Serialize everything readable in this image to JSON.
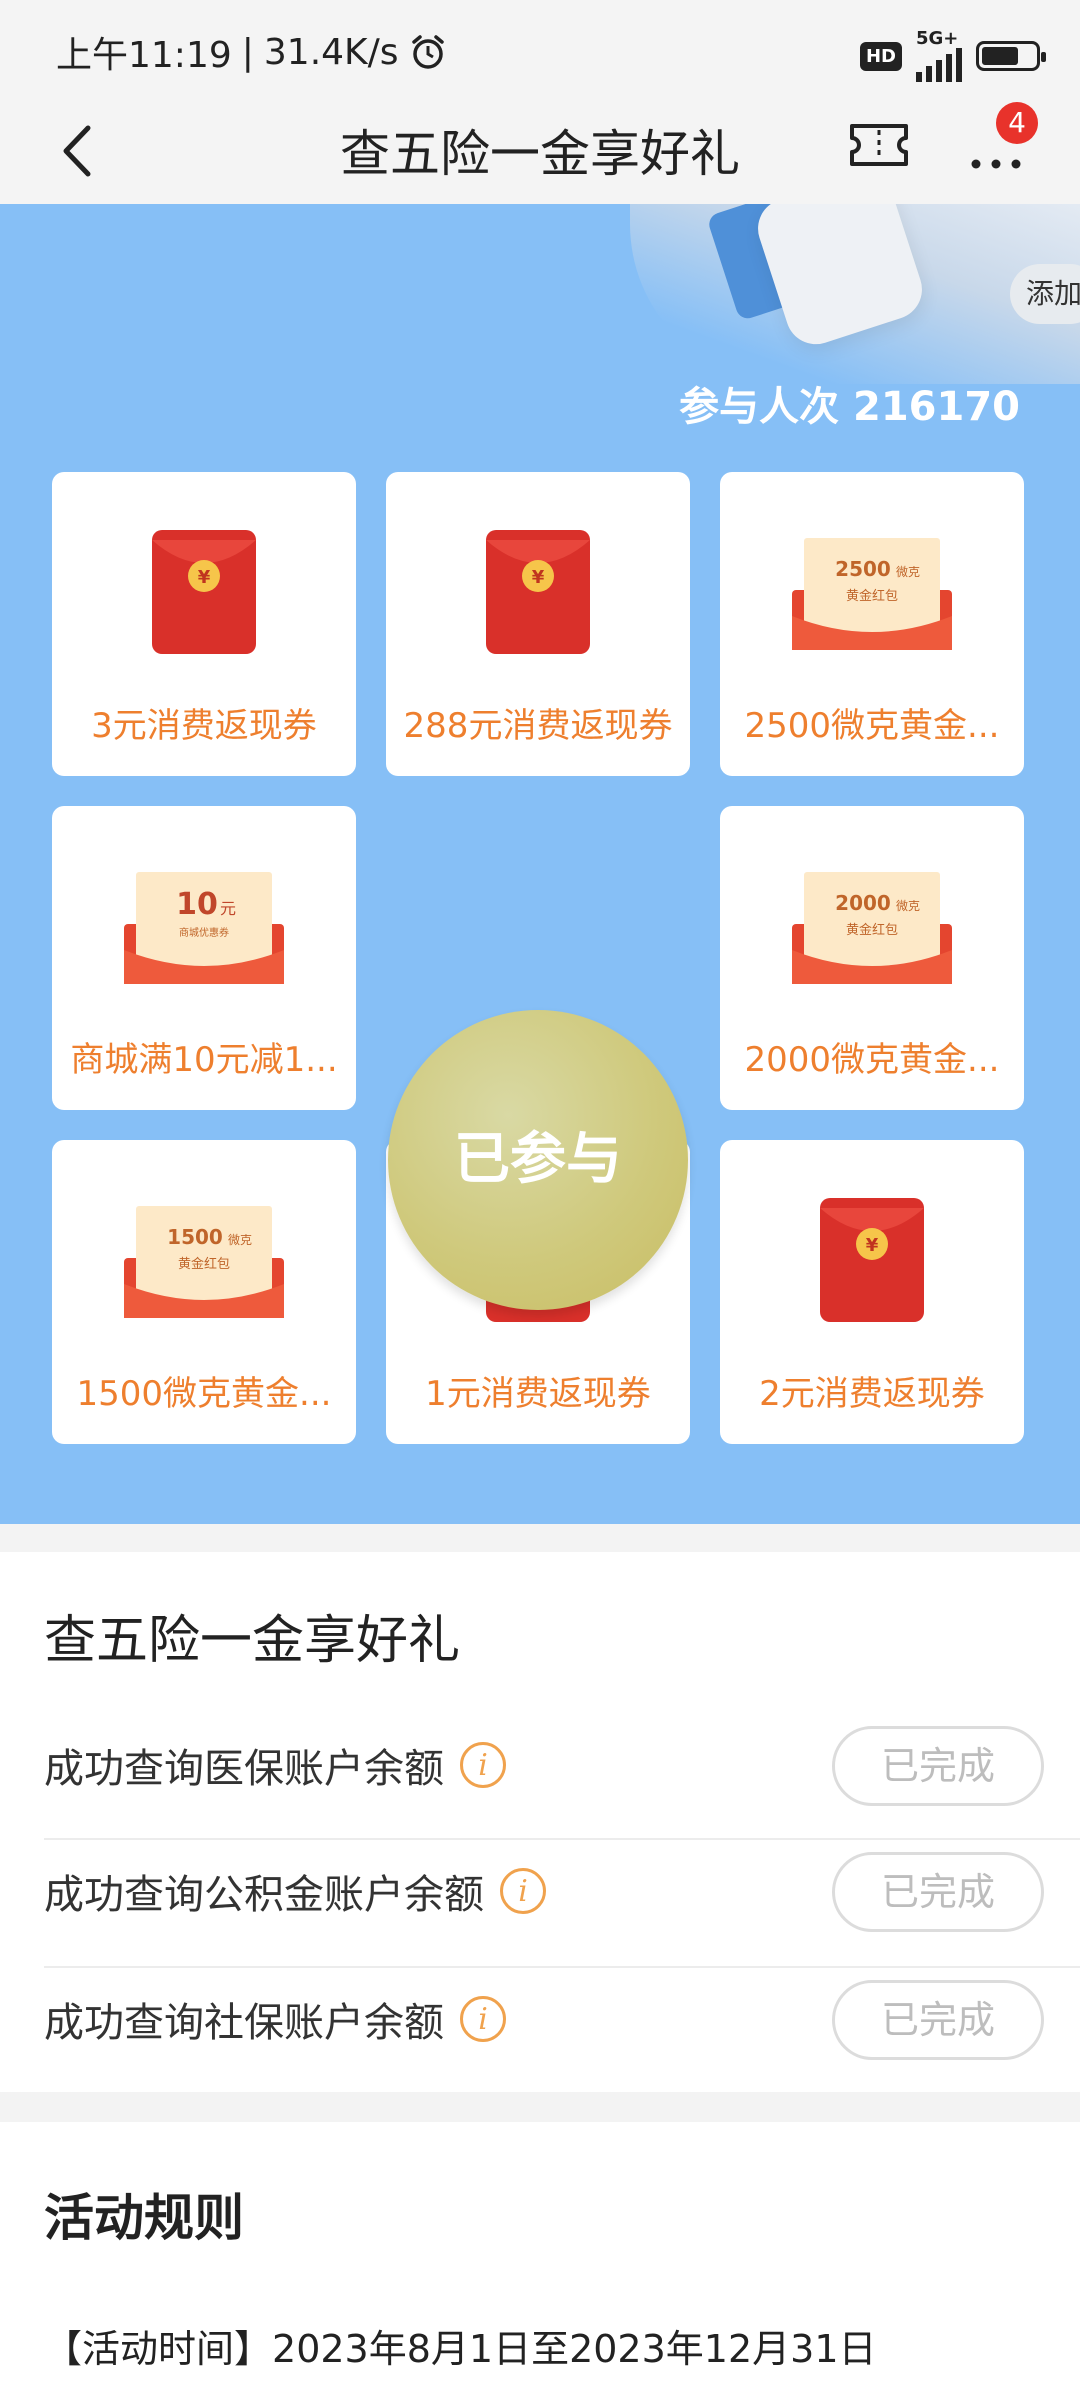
{
  "status_bar": {
    "time": "上午11:19",
    "speed": "31.4K/s",
    "hd": "HD",
    "network": "5G+"
  },
  "nav": {
    "title": "查五险一金享好礼",
    "badge_count": "4"
  },
  "banner": {
    "add_label": "添加",
    "participants_label": "参与人次",
    "participants_count": "216170",
    "center_button": "已参与",
    "prizes": [
      {
        "label": "3元消费返现券",
        "art": "red-envelope"
      },
      {
        "label": "288元消费返现券",
        "art": "red-envelope"
      },
      {
        "label": "2500微克黄金...",
        "art": "gold-envelope",
        "amount": "2500",
        "unit": "微克",
        "sub": "黄金红包"
      },
      {
        "label": "商城满10元减1...",
        "art": "coupon-envelope",
        "amount": "10",
        "unit": "元",
        "sub": "商城优惠券"
      },
      {
        "label": "2000微克黄金...",
        "art": "gold-envelope",
        "amount": "2000",
        "unit": "微克",
        "sub": "黄金红包"
      },
      {
        "label": "1500微克黄金...",
        "art": "gold-envelope",
        "amount": "1500",
        "unit": "微克",
        "sub": "黄金红包"
      },
      {
        "label": "1元消费返现券",
        "art": "red-envelope"
      },
      {
        "label": "2元消费返现券",
        "art": "red-envelope"
      }
    ]
  },
  "tasks": {
    "heading": "查五险一金享好礼",
    "items": [
      {
        "text": "成功查询医保账户余额",
        "status": "已完成"
      },
      {
        "text": "成功查询公积金账户余额",
        "status": "已完成"
      },
      {
        "text": "成功查询社保账户余额",
        "status": "已完成"
      }
    ]
  },
  "rules": {
    "heading": "活动规则",
    "time_label": "【活动时间】",
    "time_value": "2023年8月1日至2023年12月31日"
  },
  "colors": {
    "banner_bg": "#86bff6",
    "prize_text": "#ee7f2e",
    "badge": "#e8322b",
    "info_icon": "#f0a24d"
  }
}
